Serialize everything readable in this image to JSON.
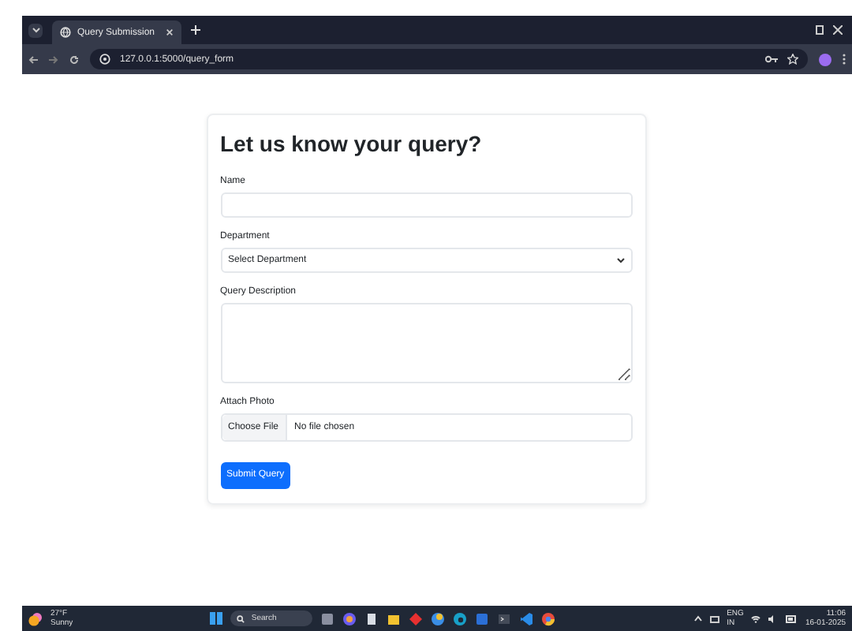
{
  "browser": {
    "tab_title": "Query Submission",
    "url": "127.0.0.1:5000/query_form"
  },
  "form": {
    "title": "Let us know your query?",
    "fields": [
      {
        "kind": "text",
        "label": "Name"
      },
      {
        "kind": "select",
        "label": "Department",
        "value": "Select Department"
      },
      {
        "kind": "textarea",
        "label": "Query Description"
      },
      {
        "kind": "file",
        "label": "Attach Photo",
        "button": "Choose File",
        "value": "No file chosen"
      }
    ],
    "submit": "Submit Query"
  },
  "taskbar": {
    "weather_temp": "27°F",
    "weather_text": "Sunny",
    "search_placeholder": "Search",
    "lang": "ENG",
    "region": "IN",
    "time": "11:06",
    "date": "16-01-2025"
  }
}
